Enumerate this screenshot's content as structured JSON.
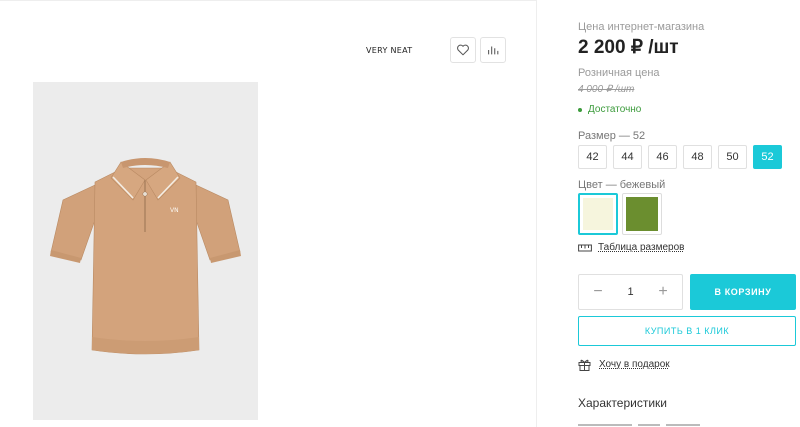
{
  "product": {
    "brand": "VERY NEAT",
    "favorite_icon": "heart-icon",
    "compare_icon": "bar-chart-icon",
    "image_background": "#ececec",
    "garment_color": "#d3a37c"
  },
  "pricing": {
    "online_label": "Цена интернет-магазина",
    "online_price": "2 200 ₽ /шт",
    "retail_label": "Розничная цена",
    "retail_price": "4 000 ₽ /шт",
    "stock_status": "Достаточно",
    "stock_color": "#3c9b3c"
  },
  "size": {
    "label": "Размер  —  52",
    "options": [
      "42",
      "44",
      "46",
      "48",
      "50",
      "52"
    ],
    "selected": "52"
  },
  "color": {
    "label": "Цвет  —  бежевый",
    "swatches": [
      {
        "name": "бежевый",
        "hex": "#f6f5dd",
        "selected": true
      },
      {
        "name": "зелёный",
        "hex": "#6b8e2f",
        "selected": false
      }
    ]
  },
  "size_table": {
    "icon": "ruler-icon",
    "label": "Таблица размеров"
  },
  "purchase": {
    "quantity": "1",
    "minus": "−",
    "plus": "+",
    "cart_label": "В КОРЗИНУ",
    "one_click_label": "КУПИТЬ В 1 КЛИК",
    "accent": "#1bc9d8"
  },
  "gift": {
    "icon": "gift-icon",
    "label": "Хочу в подарок"
  },
  "characteristics": {
    "title": "Характеристики"
  }
}
